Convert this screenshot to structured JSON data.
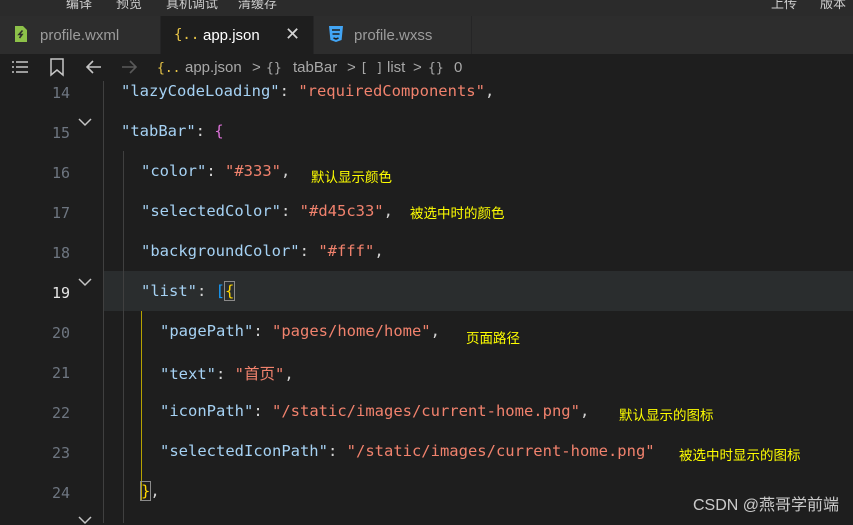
{
  "menu": {
    "items": [
      "编译",
      "预览",
      "真机调试",
      "清缓存",
      "上传",
      "版本"
    ]
  },
  "tabs": [
    {
      "label": "profile.wxml",
      "icon": "wxml-file-icon",
      "active": false
    },
    {
      "label": "app.json",
      "icon": "json-braces-icon",
      "active": true
    },
    {
      "label": "profile.wxss",
      "icon": "css-file-icon",
      "active": false
    }
  ],
  "breadcrumb": {
    "file": "app.json",
    "seg1": "tabBar",
    "seg2": "list",
    "seg3": "0"
  },
  "editor": {
    "line_numbers": [
      "14",
      "15",
      "16",
      "17",
      "18",
      "19",
      "20",
      "21",
      "22",
      "23",
      "24"
    ],
    "current_line": "19",
    "lines": {
      "l14": {
        "k": "\"lazyCodeLoading\"",
        "v": "\"requiredComponents\""
      },
      "l15": {
        "k": "\"tabBar\""
      },
      "l16": {
        "k": "\"color\"",
        "v": "\"#333\""
      },
      "l17": {
        "k": "\"selectedColor\"",
        "v": "\"#d45c33\""
      },
      "l18": {
        "k": "\"backgroundColor\"",
        "v": "\"#fff\""
      },
      "l19": {
        "k": "\"list\""
      },
      "l20": {
        "k": "\"pagePath\"",
        "v": "\"pages/home/home\""
      },
      "l21": {
        "k": "\"text\"",
        "v": "\"首页\""
      },
      "l22": {
        "k": "\"iconPath\"",
        "v": "\"/static/images/current-home.png\""
      },
      "l23": {
        "k": "\"selectedIconPath\"",
        "v": "\"/static/images/current-home.png\""
      }
    },
    "notes": {
      "color": "默认显示颜色",
      "selectedColor": "被选中时的颜色",
      "pagePath": "页面路径",
      "iconPath": "默认显示的图标",
      "selectedIconPath": "被选中时显示的图标"
    }
  },
  "watermark": "CSDN @燕哥学前端",
  "colors": {
    "key": "#a6d2f4",
    "string": "#f1826d",
    "annotation": "#ffff00",
    "background": "#1e1e1e"
  }
}
